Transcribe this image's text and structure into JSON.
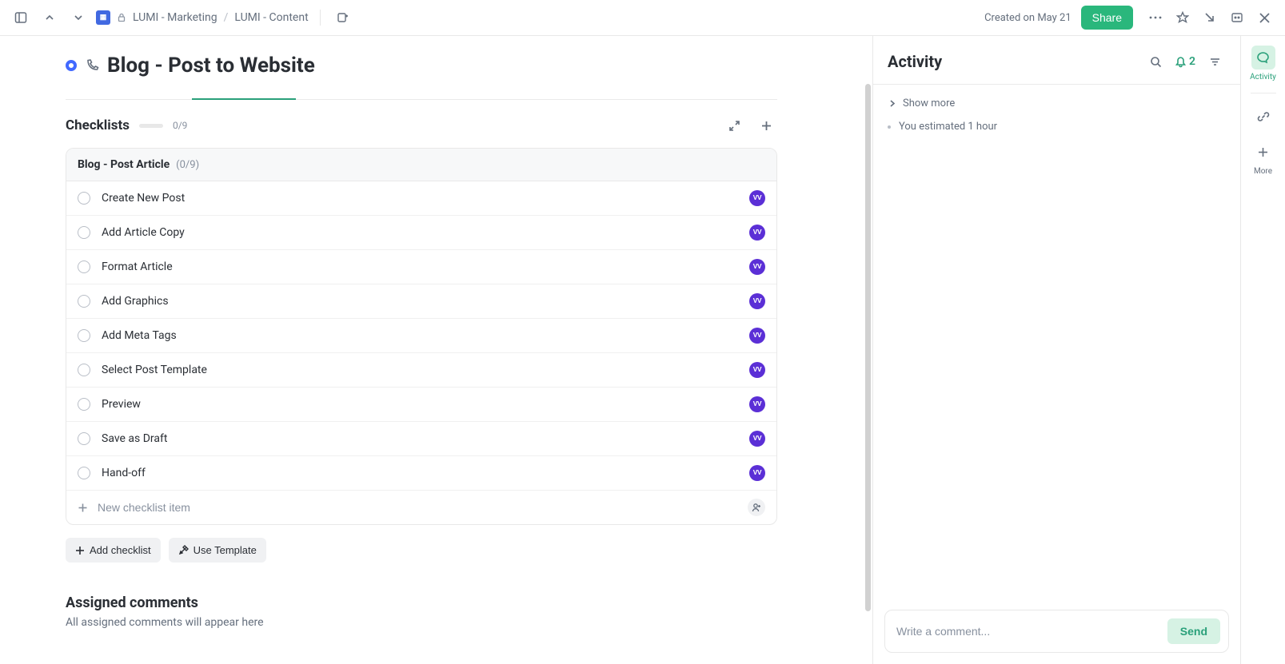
{
  "topbar": {
    "breadcrumb": [
      "LUMI - Marketing",
      "LUMI - Content"
    ],
    "created": "Created on May 21",
    "share": "Share"
  },
  "page": {
    "title": "Blog - Post to Website"
  },
  "checklists": {
    "heading": "Checklists",
    "progress": "0/9",
    "group": {
      "name": "Blog - Post Article",
      "count": "(0/9)",
      "items": [
        {
          "label": "Create New Post",
          "assignee": "VV"
        },
        {
          "label": "Add Article Copy",
          "assignee": "VV"
        },
        {
          "label": "Format Article",
          "assignee": "VV"
        },
        {
          "label": "Add Graphics",
          "assignee": "VV"
        },
        {
          "label": "Add Meta Tags",
          "assignee": "VV"
        },
        {
          "label": "Select Post Template",
          "assignee": "VV"
        },
        {
          "label": "Preview",
          "assignee": "VV"
        },
        {
          "label": "Save as Draft",
          "assignee": "VV"
        },
        {
          "label": "Hand-off",
          "assignee": "VV"
        }
      ],
      "new_item_placeholder": "New checklist item"
    },
    "add_checklist": "Add checklist",
    "use_template": "Use Template"
  },
  "assigned_comments": {
    "heading": "Assigned comments",
    "empty": "All assigned comments will appear here"
  },
  "activity": {
    "heading": "Activity",
    "notif_count": "2",
    "show_more": "Show more",
    "entries": [
      {
        "text": "You estimated 1 hour"
      }
    ],
    "comment_placeholder": "Write a comment...",
    "send": "Send"
  },
  "rail": {
    "activity": "Activity",
    "more": "More"
  }
}
